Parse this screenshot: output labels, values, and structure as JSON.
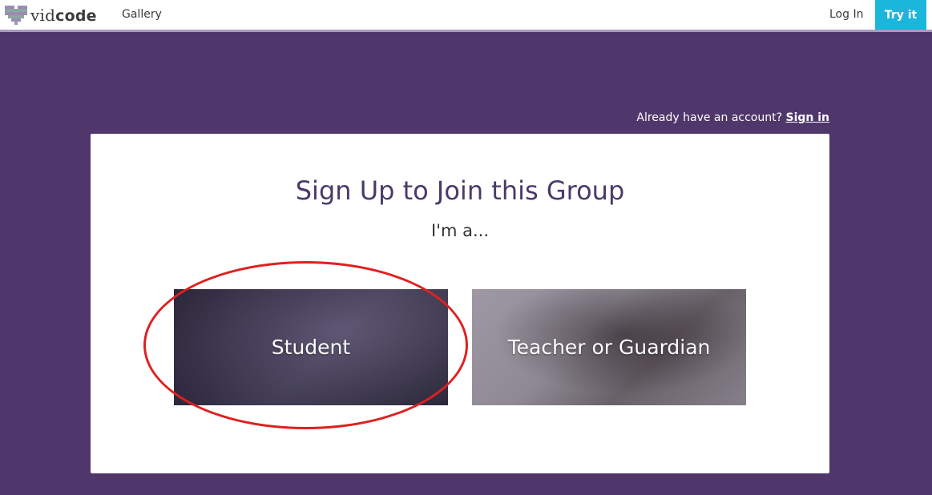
{
  "nav": {
    "logo_prefix": "vid",
    "logo_bold": "code",
    "gallery": "Gallery",
    "login": "Log In",
    "try_it": "Try it"
  },
  "account_prompt": {
    "text": "Already have an account?",
    "link": "Sign in"
  },
  "card": {
    "title": "Sign Up to Join this Group",
    "subtitle": "I'm a...",
    "options": [
      {
        "label": "Student"
      },
      {
        "label": "Teacher or Guardian"
      }
    ]
  },
  "colors": {
    "background": "#4f376b",
    "accent": "#1ab6dc",
    "title": "#4a3a6a",
    "annotation": "#e02020"
  }
}
